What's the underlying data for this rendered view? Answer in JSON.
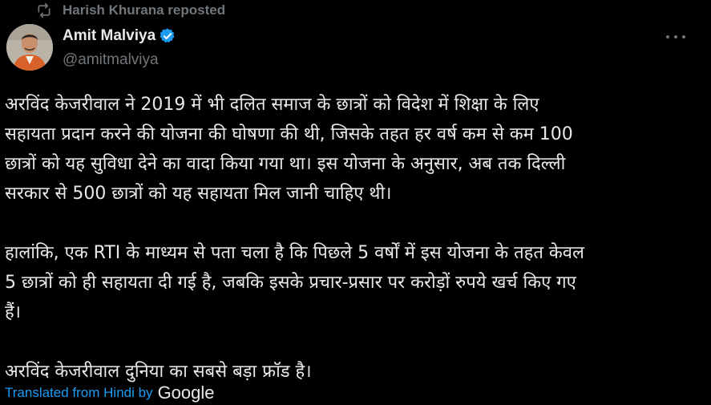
{
  "repost": {
    "label": "Harish Khurana reposted",
    "icon": "repost-icon"
  },
  "author": {
    "name": "Amit Malviya",
    "handle": "@amitmalviya",
    "verified": true,
    "verified_color": "#1d9bf0"
  },
  "tweet": {
    "lines": [
      "अरविंद केजरीवाल ने 2019 में भी दलित समाज के छात्रों को विदेश में शिक्षा के लिए",
      "सहायता प्रदान करने की योजना की घोषणा की थी, जिसके तहत हर वर्ष कम से कम 100",
      "छात्रों को यह सुविधा देने का वादा किया गया था। इस योजना के अनुसार, अब तक दिल्ली",
      "सरकार से 500 छात्रों को यह सहायता मिल जानी चाहिए थी।",
      "",
      "हालांकि, एक RTI के माध्यम से पता चला है कि पिछले 5 वर्षों में इस योजना के तहत केवल",
      "5 छात्रों को ही सहायता दी गई है, जबकि इसके प्रचार-प्रसार पर करोड़ों रुपये खर्च किए गए",
      "हैं।",
      "",
      "अरविंद केजरीवाल दुनिया का सबसे बड़ा फ्रॉड है।"
    ]
  },
  "translation": {
    "label": "Translated from Hindi by",
    "provider": "Google"
  },
  "colors": {
    "background": "#000000",
    "text": "#e7e9ea",
    "muted": "#71767b",
    "link": "#1d9bf0"
  }
}
